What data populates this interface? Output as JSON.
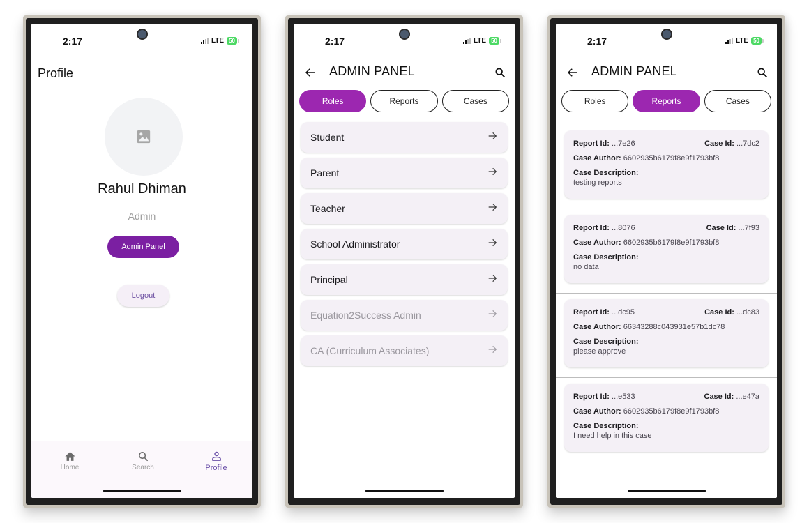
{
  "status_bar": {
    "time": "2:17",
    "network": "LTE",
    "battery": "50"
  },
  "profile_screen": {
    "title": "Profile",
    "avatar_icon": "image-placeholder-icon",
    "name": "Rahul Dhiman",
    "role": "Admin",
    "admin_panel_button": "Admin Panel",
    "logout_button": "Logout",
    "bottom_nav": [
      {
        "label": "Home",
        "icon": "home-icon",
        "active": false
      },
      {
        "label": "Search",
        "icon": "search-icon",
        "active": false
      },
      {
        "label": "Profile",
        "icon": "person-icon",
        "active": true
      }
    ]
  },
  "admin_panel": {
    "title": "ADMIN PANEL",
    "back_icon": "arrow-left-icon",
    "search_icon": "search-icon",
    "tabs": [
      "Roles",
      "Reports",
      "Cases"
    ],
    "colors": {
      "accent": "#9c27b0",
      "admin_button": "#7b1fa2",
      "card_bg": "#f4f0f6"
    }
  },
  "roles_screen": {
    "active_tab": "Roles",
    "roles": [
      {
        "label": "Student",
        "enabled": true
      },
      {
        "label": "Parent",
        "enabled": true
      },
      {
        "label": "Teacher",
        "enabled": true
      },
      {
        "label": "School Administrator",
        "enabled": true
      },
      {
        "label": "Principal",
        "enabled": true
      },
      {
        "label": "Equation2Success Admin",
        "enabled": false
      },
      {
        "label": "CA (Curriculum Associates)",
        "enabled": false
      }
    ]
  },
  "reports_screen": {
    "active_tab": "Reports",
    "labels": {
      "report_id": "Report Id:",
      "case_id": "Case Id:",
      "case_author": "Case Author:",
      "case_description": "Case Description:"
    },
    "reports": [
      {
        "report_id": "...7e26",
        "case_id": "...7dc2",
        "case_author": "6602935b6179f8e9f1793bf8",
        "description": "testing reports"
      },
      {
        "report_id": "...8076",
        "case_id": "...7f93",
        "case_author": "6602935b6179f8e9f1793bf8",
        "description": "no data"
      },
      {
        "report_id": "...dc95",
        "case_id": "...dc83",
        "case_author": "66343288c043931e57b1dc78",
        "description": "please approve"
      },
      {
        "report_id": "...e533",
        "case_id": "...e47a",
        "case_author": "6602935b6179f8e9f1793bf8",
        "description": "I need help in this case"
      }
    ]
  }
}
